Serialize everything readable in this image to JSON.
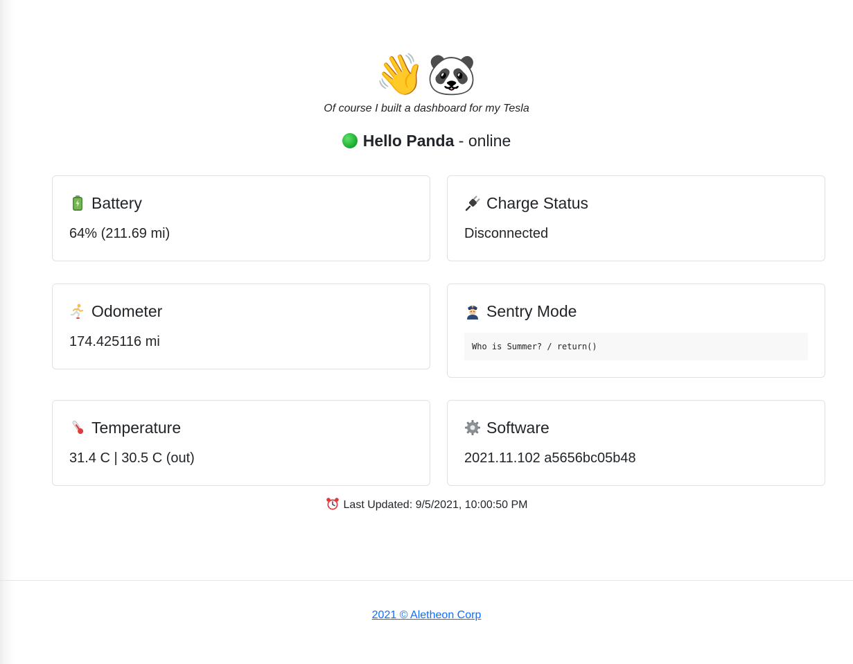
{
  "hero": {
    "emoji": "👋🐼",
    "tagline": "Of course I built a dashboard for my Tesla"
  },
  "greeting": {
    "status_color": "#1fb236",
    "name": "Hello Panda",
    "separator": " - ",
    "status": "online"
  },
  "cards": {
    "battery": {
      "title": "Battery",
      "icon": "battery-icon",
      "value": "64% (211.69 mi)"
    },
    "charge": {
      "title": "Charge Status",
      "icon": "plug-icon",
      "value": "Disconnected"
    },
    "odometer": {
      "title": "Odometer",
      "icon": "runner-icon",
      "value": "174.425116 mi"
    },
    "sentry": {
      "title": "Sentry Mode",
      "icon": "police-officer-icon",
      "value": "Who is Summer? / return()"
    },
    "temperature": {
      "title": "Temperature",
      "icon": "thermometer-icon",
      "value": "31.4 C | 30.5 C (out)"
    },
    "software": {
      "title": "Software",
      "icon": "gear-icon",
      "value": "2021.11.102 a5656bc05b48"
    }
  },
  "last_updated": {
    "icon": "alarm-clock-icon",
    "text": "Last Updated: 9/5/2021, 10:00:50 PM"
  },
  "footer": {
    "link_text": "2021 © Aletheon Corp",
    "link_color": "#0d6efd"
  }
}
